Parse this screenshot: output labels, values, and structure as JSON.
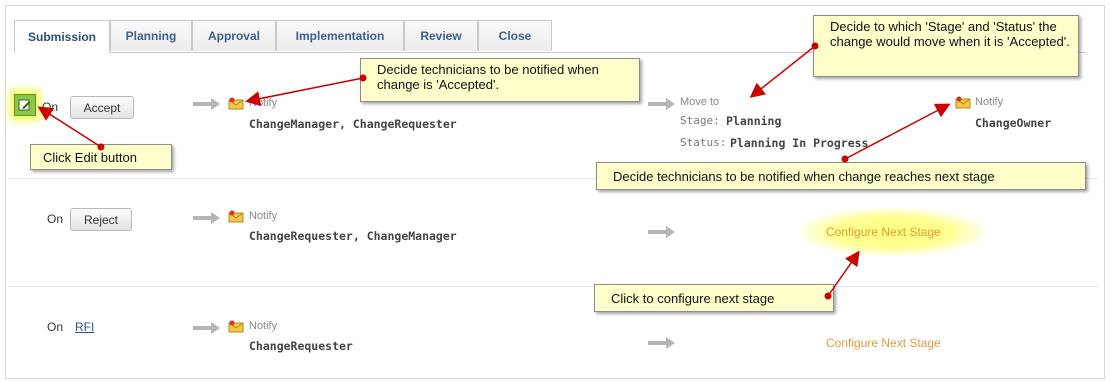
{
  "tabs": [
    "Submission",
    "Planning",
    "Approval",
    "Implementation",
    "Review",
    "Close"
  ],
  "on_label": "On",
  "rows": [
    {
      "action": "Accept",
      "notify_label": "Notify",
      "recipients": "ChangeManager, ChangeRequester",
      "move_to_label": "Move to",
      "stage_label": "Stage:",
      "stage_value": "Planning",
      "status_label": "Status:",
      "status_value": "Planning In Progress",
      "next_notify_label": "Notify",
      "next_recipients": "ChangeOwner"
    },
    {
      "action": "Reject",
      "notify_label": "Notify",
      "recipients": "ChangeRequester, ChangeManager",
      "configure_label": "Configure Next Stage"
    },
    {
      "action": "RFI",
      "notify_label": "Notify",
      "recipients": "ChangeRequester",
      "configure_label": "Configure Next Stage"
    }
  ],
  "callouts": {
    "notify_accepted": "Decide technicians to be notified when change is  'Accepted'.",
    "stage_status": "Decide to which 'Stage' and 'Status' the change would move when it is 'Accepted'.",
    "edit": "Click Edit button",
    "next_stage_notify": "Decide technicians to be notified when change reaches next stage",
    "configure": "Click to configure next stage"
  },
  "colors": {
    "tab_text": "#3d5f8f",
    "configure_link": "#e59a3a",
    "callout_bg": "#ffffcc",
    "annotation_red": "#cc0000",
    "edit_button": "#8ec64a"
  },
  "icons": {
    "arrow": "right-arrow-icon",
    "notify": "notify-envelope-icon",
    "edit": "edit-pencil-icon"
  }
}
